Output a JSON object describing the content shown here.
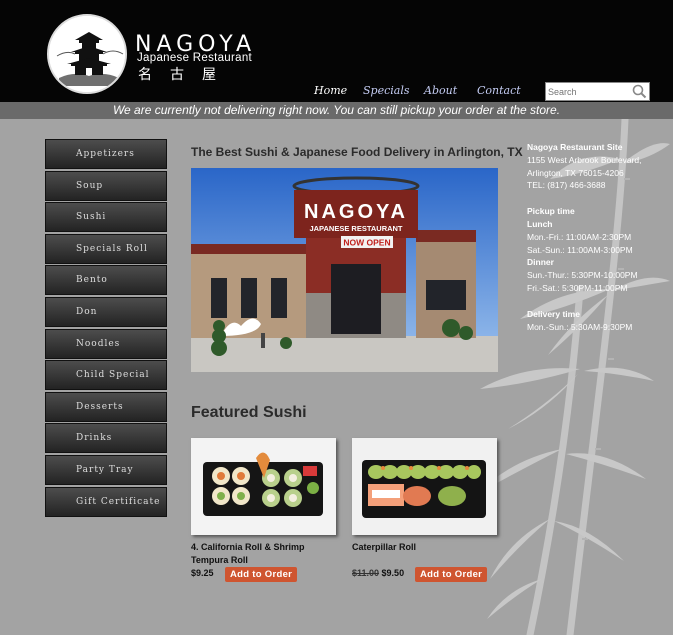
{
  "header": {
    "logo_name": "NAGOYA",
    "logo_sub": "Japanese Restaurant",
    "logo_kanji": "名古屋"
  },
  "nav": {
    "home": "Home",
    "specials": "Specials",
    "about": "About",
    "contact": "Contact"
  },
  "search": {
    "placeholder": "Search"
  },
  "notice": "We are currently not delivering right now. You can still pickup your order at the store.",
  "sidebar": {
    "items": [
      {
        "label": "Appetizers"
      },
      {
        "label": "Soup"
      },
      {
        "label": "Sushi"
      },
      {
        "label": "Specials Roll"
      },
      {
        "label": "Bento"
      },
      {
        "label": "Don"
      },
      {
        "label": "Noodles"
      },
      {
        "label": "Child Special"
      },
      {
        "label": "Desserts"
      },
      {
        "label": "Drinks"
      },
      {
        "label": "Party Tray"
      },
      {
        "label": "Gift Certificate"
      }
    ]
  },
  "main": {
    "title": "The Best Sushi & Japanese Food Delivery in Arlington, TX",
    "photo_sign": "NAGOYA",
    "photo_sign2": "JAPANESE RESTAURANT",
    "photo_banner": "NOW OPEN",
    "featured_title": "Featured Sushi",
    "products": [
      {
        "name": "4. California Roll & Shrimp Tempura Roll",
        "price": "$9.25",
        "button": "Add to Order"
      },
      {
        "name": "Caterpillar Roll",
        "old_price": "$11.00",
        "price": "$9.50",
        "button": "Add to Order"
      }
    ]
  },
  "info": {
    "site_title": "Nagoya Restaurant Site",
    "address1": "1155 West Arbrook Boulevard,",
    "address2": "Arlington, TX 76015-4206",
    "tel": "TEL: (817) 466-3688",
    "pickup_title": "Pickup time",
    "lunch_title": "Lunch",
    "lunch1": "Mon.-Fri.: 11:00AM-2:30PM",
    "lunch2": "Sat.-Sun.: 11:00AM-3:00PM",
    "dinner_title": "Dinner",
    "dinner1": "Sun.-Thur.: 5:30PM-10:00PM",
    "dinner2": "Fri.-Sat.: 5:30PM-11:00PM",
    "delivery_title": "Delivery time",
    "delivery1": "Mon.-Sun.: 5:30AM-9:30PM"
  },
  "colors": {
    "background": "#a3a3a3",
    "header": "#050505",
    "notice_bar": "#6a6a6a",
    "button": "#cf5530",
    "nav_link": "#c5cdf4"
  },
  "icons": {
    "search": "magnifier-icon",
    "logo": "castle-logo-icon"
  }
}
